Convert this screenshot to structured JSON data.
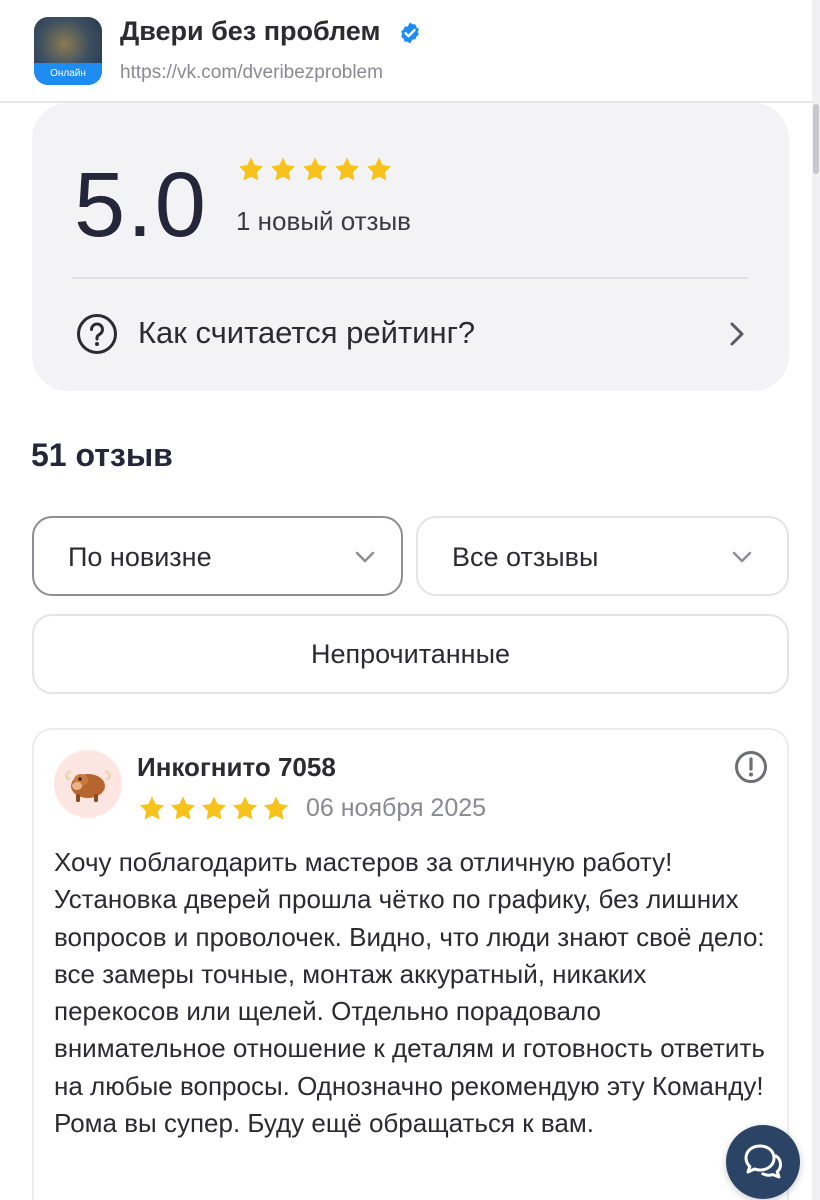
{
  "header": {
    "org_name": "Двери без проблем",
    "online_badge": "Онлайн",
    "url": "https://vk.com/dveribezproblem"
  },
  "rating": {
    "value": "5.0",
    "stars": 5,
    "new_reviews": "1 новый отзыв",
    "how_calculated": "Как считается рейтинг?"
  },
  "reviews": {
    "title": "51 отзыв",
    "sort_label": "По новизне",
    "filter_label": "Все отзывы",
    "unread_label": "Непрочитанные"
  },
  "review": {
    "author": "Инкогнито 7058",
    "stars": 5,
    "date": "06 ноября 2025",
    "text": "Хочу поблагодарить мастеров за отличную работу! Установка дверей прошла чётко по графику, без лишних вопросов и проволочек. Видно, что люди знают своё дело: все замеры точные, монтаж аккуратный, никаких перекосов или щелей. Отдельно порадовало внимательное отношение к деталям и готовность ответить на любые вопросы. Однозначно рекомендую эту Команду! Рома вы супер. Буду ещё обращаться к вам."
  },
  "colors": {
    "star": "#f7c21c",
    "accent_blue": "#1e8cf0",
    "card_bg": "#f3f3f6",
    "chat_button": "#2b4466"
  },
  "icons": {
    "verified": "verified-check-icon",
    "help": "question-circle-icon",
    "chevron_right": "chevron-right-icon",
    "chevron_down": "chevron-down-icon",
    "report": "exclamation-circle-icon",
    "chat": "chat-bubbles-icon"
  }
}
